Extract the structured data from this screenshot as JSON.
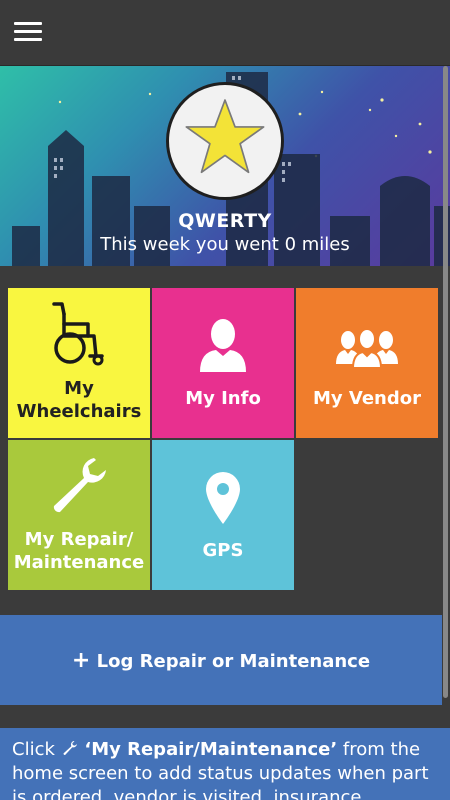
{
  "header": {
    "menu_icon": "hamburger-menu-icon"
  },
  "profile": {
    "avatar_icon": "star-icon",
    "username": "QWERTY",
    "week_summary": "This week you went 0 miles"
  },
  "tiles": [
    {
      "label_line1": "My",
      "label_line2": "Wheelchairs",
      "icon": "wheelchair-icon",
      "color": "#f9f640"
    },
    {
      "label": "My Info",
      "icon": "user-icon",
      "color": "#e8308f"
    },
    {
      "label": "My Vendor",
      "icon": "group-icon",
      "color": "#f07d2c"
    },
    {
      "label_line1": "My Repair/",
      "label_line2": "Maintenance",
      "icon": "wrench-icon",
      "color": "#a9c93c"
    },
    {
      "label": "GPS",
      "icon": "map-pin-icon",
      "color": "#5ec3d9"
    }
  ],
  "log_button": {
    "plus": "+",
    "label": "Log Repair or Maintenance",
    "color": "#4472b8"
  },
  "tip": {
    "prefix": "Click",
    "emphasis": "‘My Repair/Maintenance’",
    "suffix": "from the home screen to add status updates when part is ordered, vendor is visited, insurance"
  }
}
